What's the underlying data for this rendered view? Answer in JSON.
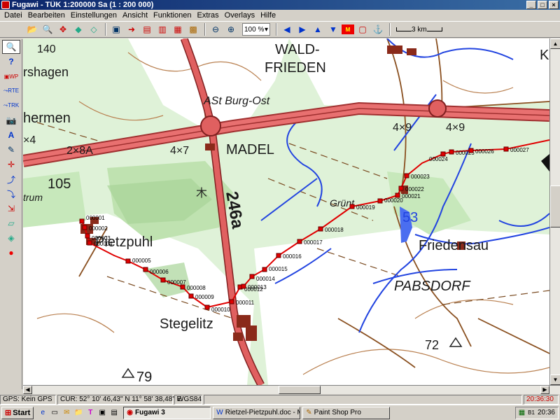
{
  "window": {
    "title": "Fugawi - TÜK 1:200000 Sa  (1 : 200 000)",
    "minimize": "_",
    "maximize": "□",
    "close": "×"
  },
  "menu": [
    "Datei",
    "Bearbeiten",
    "Einstellungen",
    "Ansicht",
    "Funktionen",
    "Extras",
    "Overlays",
    "Hilfe"
  ],
  "toolbar": {
    "zoom": "100 %",
    "scale_label": "3 km"
  },
  "map": {
    "labels": {
      "elev_140": "140",
      "rshagen": "rshagen",
      "wald": "WALD-",
      "frieden": "FRIEDEN",
      "ast_burg": "ASt Burg-Ost",
      "hermen": "hermen",
      "x4": "×4",
      "road_2x8a": "2×8A",
      "lanes_4x7": "4×7",
      "madel": "MADEL",
      "lanes_4x9a": "4×9",
      "lanes_4x9b": "4×9",
      "elev_105": "105",
      "trum": "trum",
      "route_246a": "246a",
      "grunt": "Grünt",
      "num_53": "53",
      "pietzpuhl": "Pietzpuhl",
      "friedensau": "Friedensau",
      "pabsdorf": "PABSDORF",
      "stegelitz": "Stegelitz",
      "elev_72": "72",
      "elev_79": "79",
      "k_edge": "K"
    },
    "waypoints": [
      "000001",
      "000002",
      "000003",
      "000004",
      "000005",
      "000006",
      "000007",
      "000008",
      "000009",
      "000010",
      "000011",
      "000012",
      "000013",
      "000014",
      "000015",
      "000016",
      "000017",
      "000018",
      "000019",
      "000020",
      "000021",
      "000022",
      "000023",
      "000024",
      "000025",
      "000026",
      "000027"
    ]
  },
  "statusbar": {
    "gps": "GPS: Kein GPS",
    "cursor": "CUR: 52° 10' 46,43\" N 11° 58' 38,48\" E",
    "datum": "WGS84",
    "time": "20:36:30"
  },
  "taskbar": {
    "start": "Start",
    "tasks": [
      "Fugawi 3",
      "Rietzel-Pietzpuhl.doc - Mic...",
      "Paint Shop Pro"
    ],
    "clock": "20:36"
  },
  "colors": {
    "field": "#d9f0d0",
    "forest": "#a8d8a0",
    "road_red": "#e0605a",
    "road_main": "#d84848",
    "water": "#1f3fd8",
    "contour": "#b07840",
    "track": "#e00000"
  }
}
